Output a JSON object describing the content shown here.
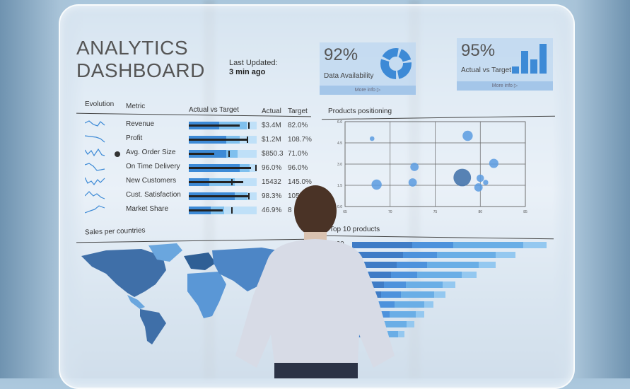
{
  "dashboard": {
    "title_line1": "ANALYTICS",
    "title_line2": "DASHBOARD",
    "last_updated_label": "Last Updated:",
    "last_updated_value": "3 min ago"
  },
  "kpis": [
    {
      "value": "92%",
      "label": "Data Availability",
      "more": "More info",
      "icon": "donut-chart-icon",
      "percent": 92
    },
    {
      "value": "95%",
      "label": "Actual vs Target",
      "more": "More info",
      "icon": "bar-chart-icon",
      "percent": 95
    }
  ],
  "metrics_table": {
    "headers": {
      "evolution": "Evolution",
      "metric": "Metric",
      "avt": "Actual vs Target",
      "actual": "Actual",
      "target": "Target"
    },
    "rows": [
      {
        "metric": "Revenue",
        "actual": "$3.4M",
        "target": "82.0%",
        "highlight": false
      },
      {
        "metric": "Profit",
        "actual": "$1.2M",
        "target": "108.7%",
        "highlight": false
      },
      {
        "metric": "Avg. Order Size",
        "actual": "$850.3",
        "target": "71.0%",
        "highlight": true
      },
      {
        "metric": "On Time Delivery",
        "actual": "96.0%",
        "target": "96.0%",
        "highlight": false
      },
      {
        "metric": "New Customers",
        "actual": "15432",
        "target": "145.0%",
        "highlight": false
      },
      {
        "metric": "Cust. Satisfaction",
        "actual": "98.3%",
        "target": "105%",
        "highlight": false
      },
      {
        "metric": "Market Share",
        "actual": "46.9%",
        "target": "8",
        "highlight": false
      }
    ]
  },
  "products_positioning": {
    "title": "Products positioning",
    "x_ticks": [
      "65",
      "70",
      "75",
      "80",
      "85"
    ],
    "y_ticks": [
      "0.0",
      "1.5",
      "3.0",
      "4.5",
      "6.0"
    ],
    "xlim": [
      65,
      85
    ],
    "ylim": [
      0,
      6
    ],
    "points": [
      {
        "x": 68.0,
        "y": 4.8,
        "size": 1
      },
      {
        "x": 78.6,
        "y": 5.0,
        "size": 4
      },
      {
        "x": 72.7,
        "y": 2.8,
        "size": 3
      },
      {
        "x": 81.5,
        "y": 3.05,
        "size": 3.5
      },
      {
        "x": 68.5,
        "y": 1.55,
        "size": 4
      },
      {
        "x": 72.5,
        "y": 1.7,
        "size": 3
      },
      {
        "x": 78.0,
        "y": 2.05,
        "size": 8,
        "dark": true
      },
      {
        "x": 80.0,
        "y": 2.0,
        "size": 2.5
      },
      {
        "x": 80.6,
        "y": 1.7,
        "size": 1.3
      },
      {
        "x": 79.8,
        "y": 1.35,
        "size": 3
      }
    ]
  },
  "sales_per_countries": {
    "title": "Sales per countries"
  },
  "top_products": {
    "title": "Top 10 products",
    "top_value": "430",
    "bars": [
      1.0,
      0.84,
      0.74,
      0.64,
      0.53,
      0.48,
      0.42,
      0.37,
      0.32,
      0.27
    ]
  },
  "colors": {
    "accent": "#3d8ad6",
    "accent_light": "#7fc0ee",
    "accent_pale": "#bfe0f8",
    "dark": "#2f5f95"
  }
}
